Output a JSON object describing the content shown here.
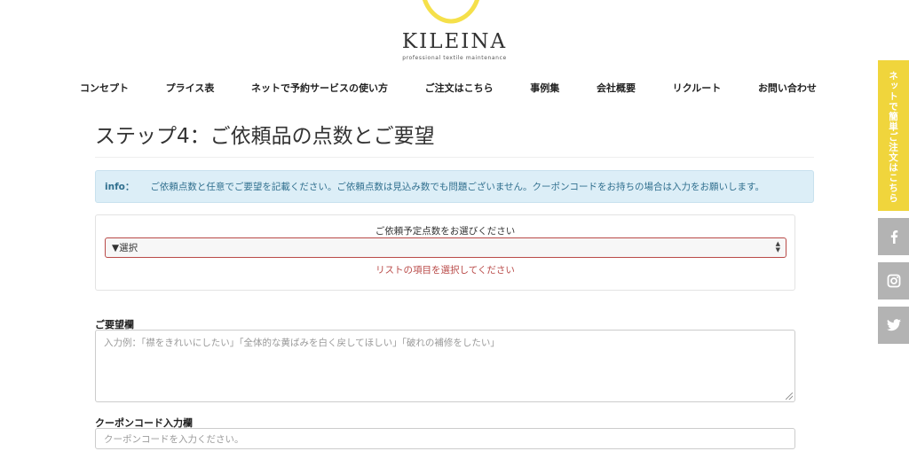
{
  "header": {
    "logo_text": "KILEINA",
    "logo_sub": "professional textile maintenance",
    "brand_color": "#f5e04a"
  },
  "nav": {
    "items": [
      "コンセプト",
      "プライス表",
      "ネットで予約サービスの使い方",
      "ご注文はこちら",
      "事例集",
      "会社概要",
      "リクルート",
      "お問い合わせ"
    ]
  },
  "main": {
    "title": "ステップ4：ご依頼品の点数とご要望",
    "info": {
      "label": "info：",
      "text": "ご依頼点数と任意でご要望を記載ください。ご依頼点数は見込み数でも問題ございません。クーポンコードをお持ちの場合は入力をお願いします。"
    },
    "count_select": {
      "label": "ご依頼予定点数をお選びください",
      "selected": "▼選択",
      "error": "リストの項目を選択してください"
    },
    "request_field": {
      "label": "ご要望欄",
      "placeholder": "入力例：「襟をきれいにしたい」「全体的な黄ばみを白く戻してほしい」「破れの補修をしたい」"
    },
    "coupon_field": {
      "label": "クーポンコード入力欄",
      "placeholder": "クーポンコードを入力ください。"
    }
  },
  "side": {
    "cta_label": "ネットで簡単ご注文はこちら",
    "cta_color": "#f0d53c",
    "social_icons": [
      "facebook-icon",
      "instagram-icon",
      "twitter-icon"
    ]
  },
  "colors": {
    "info_bg": "#dceef7",
    "info_text": "#31708f",
    "error": "#b94a48",
    "side_gray": "#b3b3b3"
  }
}
